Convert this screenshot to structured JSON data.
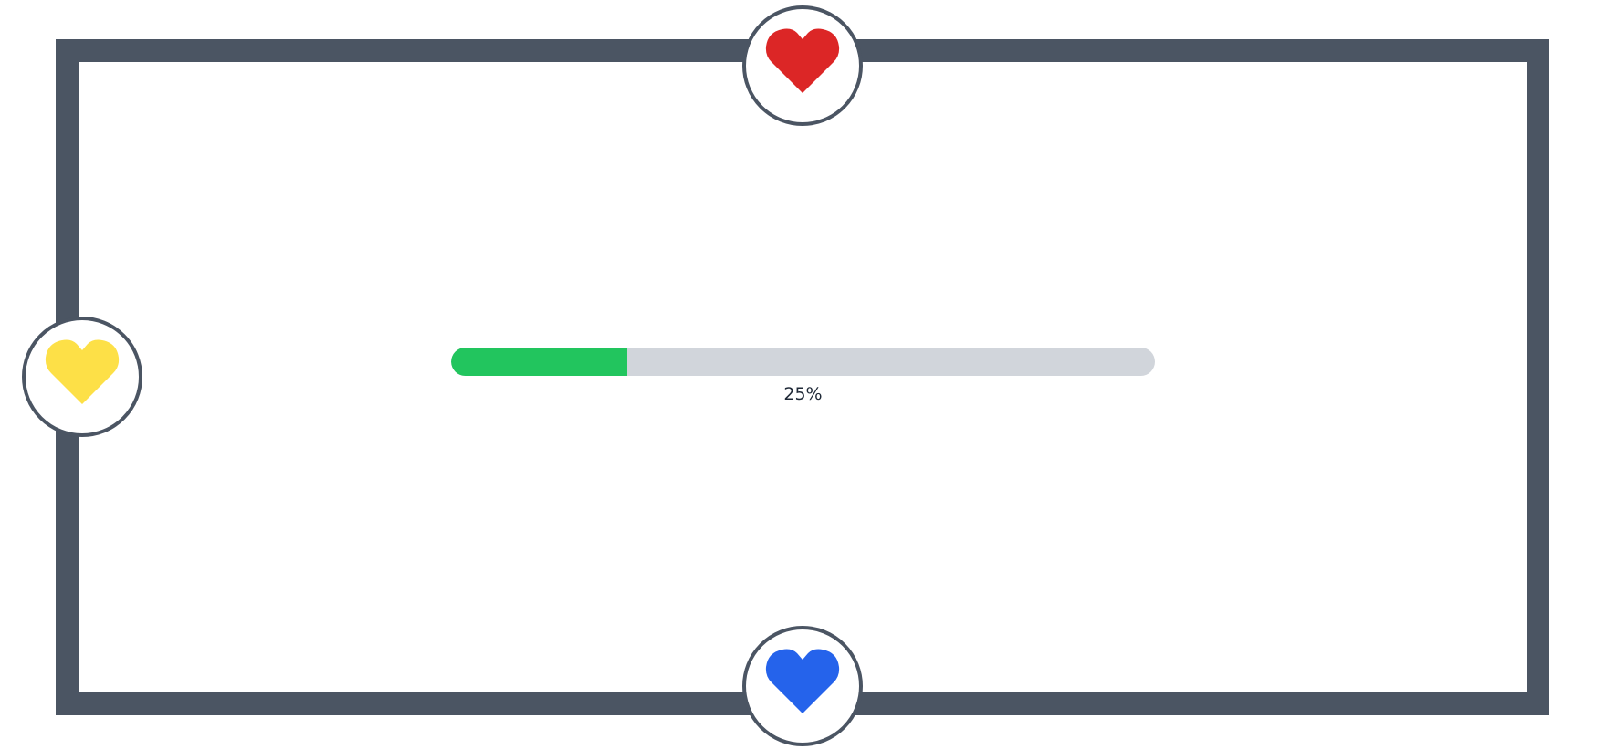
{
  "progress": {
    "fraction": 0.25,
    "label": "25%",
    "fill_color": "#22c55e",
    "track_color": "#d1d5db"
  },
  "frame": {
    "border_color": "#4b5563"
  },
  "hearts": {
    "top": {
      "icon": "heart-icon",
      "color": "#dc2626"
    },
    "left": {
      "icon": "heart-icon",
      "color": "#fde047"
    },
    "bottom": {
      "icon": "heart-icon",
      "color": "#2563eb"
    }
  }
}
